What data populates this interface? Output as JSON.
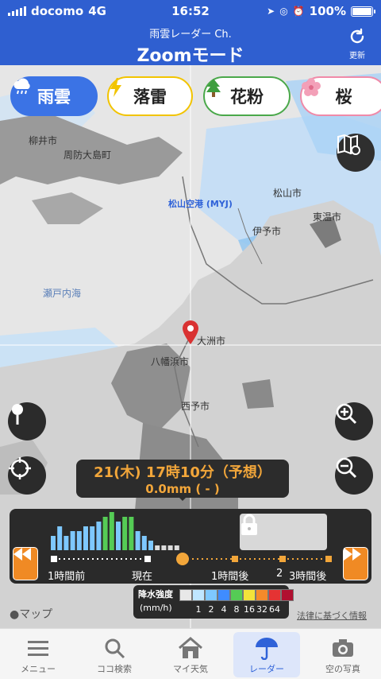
{
  "status": {
    "carrier": "docomo",
    "network": "4G",
    "time": "16:52",
    "battery": "100%"
  },
  "header": {
    "subtitle": "雨雲レーダー Ch.",
    "title": "Zoomモード",
    "refresh_label": "更新"
  },
  "layers": [
    {
      "label": "雨雲",
      "icon": "rain-cloud-icon"
    },
    {
      "label": "落雷",
      "icon": "lightning-icon"
    },
    {
      "label": "花粉",
      "icon": "tree-icon"
    },
    {
      "label": "桜",
      "icon": "sakura-icon"
    }
  ],
  "map": {
    "places": [
      {
        "name": "柳井市"
      },
      {
        "name": "周防大島町"
      },
      {
        "name": "松山空港 (MYJ)"
      },
      {
        "name": "松山市"
      },
      {
        "name": "東温市"
      },
      {
        "name": "伊予市"
      },
      {
        "name": "瀬戸内海"
      },
      {
        "name": "大洲市"
      },
      {
        "name": "八幡浜市"
      },
      {
        "name": "西予市"
      }
    ],
    "apple_maps": "マップ",
    "legal": "法律に基づく情報"
  },
  "forecast": {
    "time": "21(木) 17時10分（予想）",
    "amount": "0.0mm (      -      )"
  },
  "timeline": {
    "labels": [
      "1時間前",
      "現在",
      "1時間後",
      "2",
      "3時間後"
    ],
    "bars": [
      3,
      5,
      3,
      4,
      4,
      5,
      5,
      6,
      7,
      8,
      6,
      7,
      7,
      4,
      3,
      2,
      1,
      1,
      1,
      1
    ]
  },
  "legend": {
    "title": "降水強度",
    "unit": "(mm/h)",
    "values": [
      "1",
      "2",
      "4",
      "8",
      "16",
      "32",
      "64"
    ],
    "colors": [
      "#e8e8e8",
      "#bfe6ff",
      "#7ec8ff",
      "#3f8cff",
      "#55cc55",
      "#f3e33a",
      "#f58a2a",
      "#e53333",
      "#b01030"
    ]
  },
  "tabs": [
    {
      "label": "メニュー",
      "icon": "menu-icon"
    },
    {
      "label": "ココ検索",
      "icon": "search-icon"
    },
    {
      "label": "マイ天気",
      "icon": "home-icon"
    },
    {
      "label": "レーダー",
      "icon": "umbrella-icon"
    },
    {
      "label": "空の写真",
      "icon": "camera-icon"
    }
  ]
}
